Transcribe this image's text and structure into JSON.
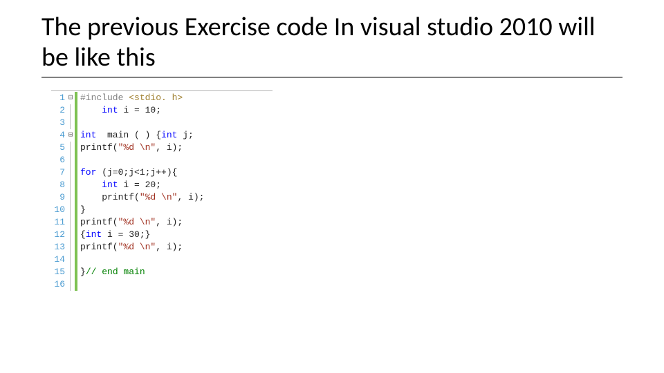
{
  "title": "The previous Exercise code In visual studio 2010 will be like this",
  "code": {
    "lines": [
      {
        "n": "1",
        "fold": "⊟",
        "tokens": [
          {
            "t": "#include ",
            "c": "inc"
          },
          {
            "t": "<stdio. h>",
            "c": "incf"
          }
        ]
      },
      {
        "n": "2",
        "fold": "",
        "tokens": [
          {
            "t": "    ",
            "c": "pln"
          },
          {
            "t": "int",
            "c": "type"
          },
          {
            "t": " i = 10;",
            "c": "pln"
          }
        ]
      },
      {
        "n": "3",
        "fold": "",
        "tokens": []
      },
      {
        "n": "4",
        "fold": "⊟",
        "tokens": [
          {
            "t": "int",
            "c": "type"
          },
          {
            "t": "  main ( ) {",
            "c": "pln"
          },
          {
            "t": "int",
            "c": "type"
          },
          {
            "t": " j;",
            "c": "pln"
          }
        ]
      },
      {
        "n": "5",
        "fold": "",
        "tokens": [
          {
            "t": "printf(",
            "c": "pln"
          },
          {
            "t": "\"%d \\n\"",
            "c": "str"
          },
          {
            "t": ", i);",
            "c": "pln"
          }
        ]
      },
      {
        "n": "6",
        "fold": "",
        "tokens": []
      },
      {
        "n": "7",
        "fold": "",
        "tokens": [
          {
            "t": "for",
            "c": "kw"
          },
          {
            "t": " (j=0;j<1;j++){",
            "c": "pln"
          }
        ]
      },
      {
        "n": "8",
        "fold": "",
        "tokens": [
          {
            "t": "    ",
            "c": "pln"
          },
          {
            "t": "int",
            "c": "type"
          },
          {
            "t": " i = 20;",
            "c": "pln"
          }
        ]
      },
      {
        "n": "9",
        "fold": "",
        "tokens": [
          {
            "t": "    printf(",
            "c": "pln"
          },
          {
            "t": "\"%d \\n\"",
            "c": "str"
          },
          {
            "t": ", i);",
            "c": "pln"
          }
        ]
      },
      {
        "n": "10",
        "fold": "",
        "tokens": [
          {
            "t": "}",
            "c": "pln"
          }
        ]
      },
      {
        "n": "11",
        "fold": "",
        "tokens": [
          {
            "t": "printf(",
            "c": "pln"
          },
          {
            "t": "\"%d \\n\"",
            "c": "str"
          },
          {
            "t": ", i);",
            "c": "pln"
          }
        ]
      },
      {
        "n": "12",
        "fold": "",
        "tokens": [
          {
            "t": "{",
            "c": "pln"
          },
          {
            "t": "int",
            "c": "type"
          },
          {
            "t": " i = 30;}",
            "c": "pln"
          }
        ]
      },
      {
        "n": "13",
        "fold": "",
        "tokens": [
          {
            "t": "printf(",
            "c": "pln"
          },
          {
            "t": "\"%d \\n\"",
            "c": "str"
          },
          {
            "t": ", i);",
            "c": "pln"
          }
        ]
      },
      {
        "n": "14",
        "fold": "",
        "tokens": []
      },
      {
        "n": "15",
        "fold": "",
        "tokens": [
          {
            "t": "}",
            "c": "pln"
          },
          {
            "t": "// end main",
            "c": "cmt"
          }
        ]
      },
      {
        "n": "16",
        "fold": "",
        "tokens": []
      }
    ]
  }
}
